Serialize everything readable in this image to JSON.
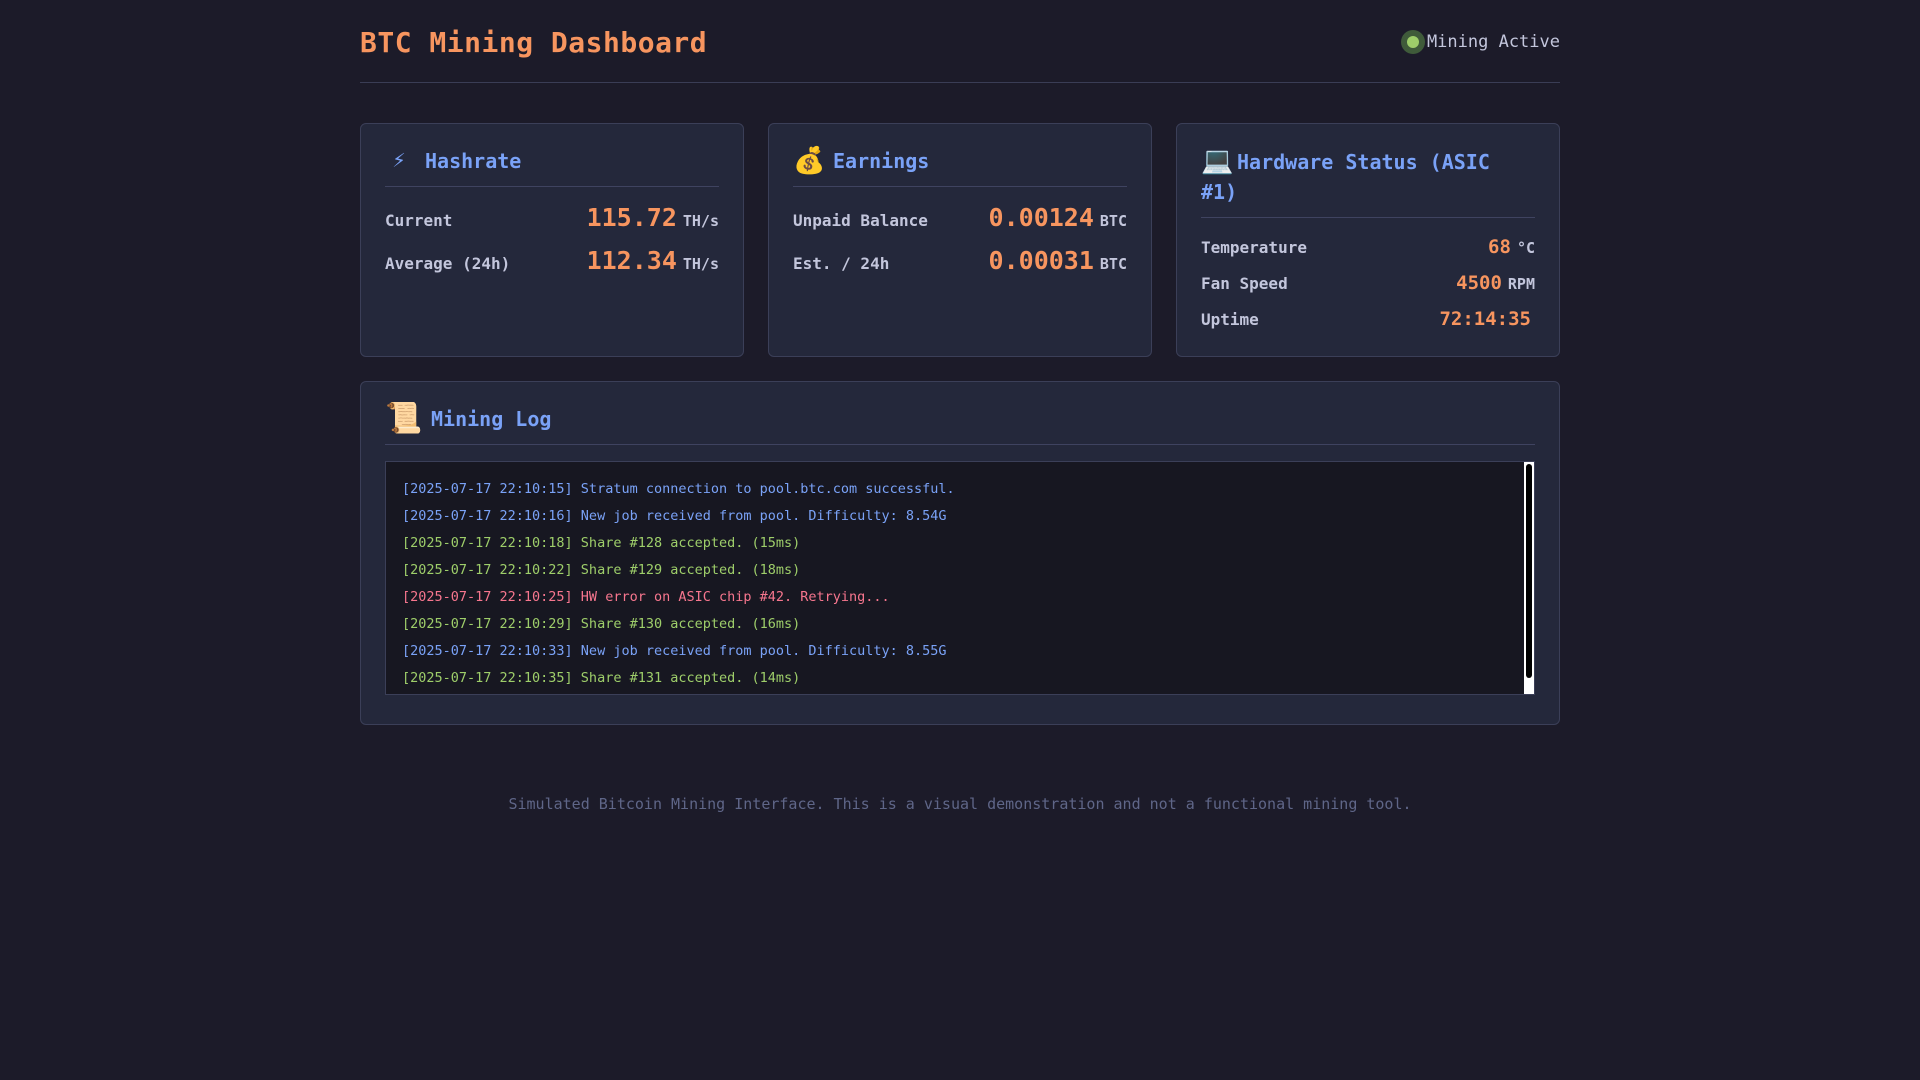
{
  "header": {
    "title": "BTC Mining Dashboard",
    "status": "Mining Active",
    "status_color": "#9ece6a"
  },
  "cards": {
    "hashrate": {
      "icon": "⚡",
      "title": "Hashrate",
      "rows": [
        {
          "label": "Current",
          "value": "115.72",
          "unit": "TH/s"
        },
        {
          "label": "Average (24h)",
          "value": "112.34",
          "unit": "TH/s"
        }
      ]
    },
    "earnings": {
      "icon": "💰",
      "title": "Earnings",
      "rows": [
        {
          "label": "Unpaid Balance",
          "value": "0.00124",
          "unit": "BTC"
        },
        {
          "label": "Est. / 24h",
          "value": "0.00031",
          "unit": "BTC"
        }
      ]
    },
    "hardware": {
      "icon": "💻",
      "title": "Hardware Status (ASIC #1)",
      "rows": [
        {
          "label": "Temperature",
          "value": "68",
          "unit": "°C"
        },
        {
          "label": "Fan Speed",
          "value": "4500",
          "unit": "RPM"
        },
        {
          "label": "Uptime",
          "value": "72:14:35",
          "unit": ""
        }
      ]
    }
  },
  "log": {
    "icon": "📜",
    "title": "Mining Log",
    "lines": [
      {
        "text": "[2025-07-17 22:10:15] Stratum connection to pool.btc.com successful.",
        "type": "info"
      },
      {
        "text": "[2025-07-17 22:10:16] New job received from pool. Difficulty: 8.54G",
        "type": "info"
      },
      {
        "text": "[2025-07-17 22:10:18] Share #128 accepted. (15ms)",
        "type": "ok"
      },
      {
        "text": "[2025-07-17 22:10:22] Share #129 accepted. (18ms)",
        "type": "ok"
      },
      {
        "text": "[2025-07-17 22:10:25] HW error on ASIC chip #42. Retrying...",
        "type": "err"
      },
      {
        "text": "[2025-07-17 22:10:29] Share #130 accepted. (16ms)",
        "type": "ok"
      },
      {
        "text": "[2025-07-17 22:10:33] New job received from pool. Difficulty: 8.55G",
        "type": "info"
      },
      {
        "text": "[2025-07-17 22:10:35] Share #131 accepted. (14ms)",
        "type": "ok"
      }
    ]
  },
  "footer": {
    "text": "Simulated Bitcoin Mining Interface. This is a visual demonstration and not a functional mining tool."
  },
  "colors": {
    "accent": "#f7955f",
    "heading": "#7aa2f7",
    "ok": "#9ece6a",
    "error": "#f7768e",
    "background": "#1c1b29",
    "card": "#24283b"
  }
}
